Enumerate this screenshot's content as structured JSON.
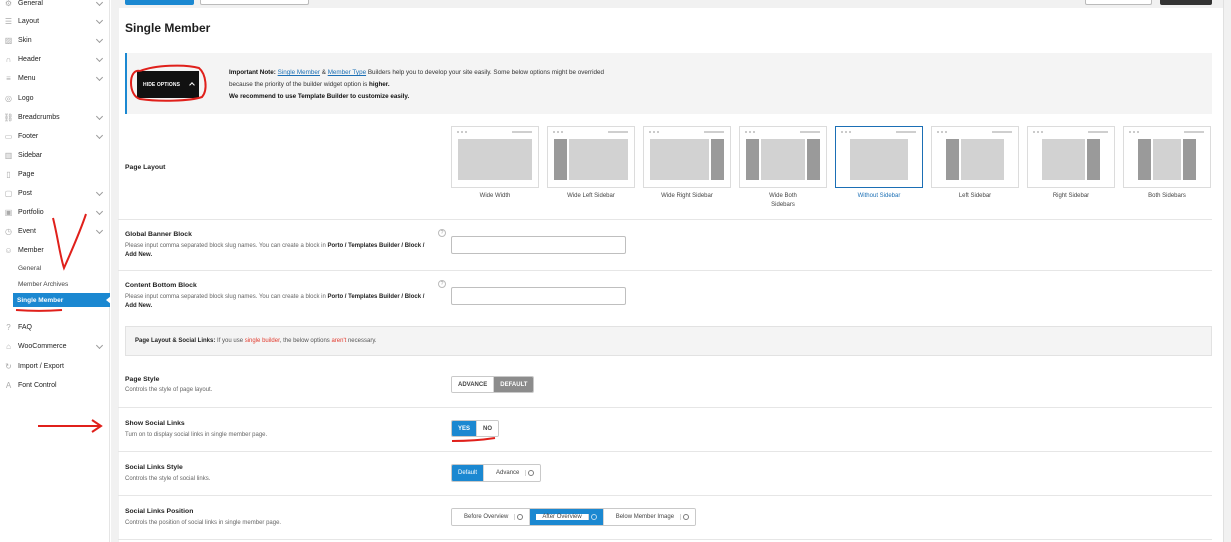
{
  "sidebar": {
    "items": [
      {
        "label": "General",
        "icon": "gear-icon",
        "chevron": true
      },
      {
        "label": "Layout",
        "icon": "layout-icon",
        "chevron": true
      },
      {
        "label": "Skin",
        "icon": "image-icon",
        "chevron": true
      },
      {
        "label": "Header",
        "icon": "header-icon",
        "chevron": true
      },
      {
        "label": "Menu",
        "icon": "menu-icon",
        "chevron": true
      },
      {
        "label": "Logo",
        "icon": "logo-icon",
        "chevron": false
      },
      {
        "label": "Breadcrumbs",
        "icon": "link-icon",
        "chevron": true
      },
      {
        "label": "Footer",
        "icon": "footer-icon",
        "chevron": true
      },
      {
        "label": "Sidebar",
        "icon": "sidebar-icon",
        "chevron": false
      },
      {
        "label": "Page",
        "icon": "page-icon",
        "chevron": false
      },
      {
        "label": "Post",
        "icon": "post-icon",
        "chevron": true
      },
      {
        "label": "Portfolio",
        "icon": "portfolio-icon",
        "chevron": true
      },
      {
        "label": "Event",
        "icon": "event-icon",
        "chevron": true
      },
      {
        "label": "Member",
        "icon": "member-icon",
        "chevron": false
      }
    ],
    "member_sub": [
      "General",
      "Member Archives",
      "Single Member"
    ],
    "bottom_items": [
      {
        "label": "FAQ",
        "icon": "question-icon"
      },
      {
        "label": "WooCommerce",
        "icon": "cart-icon",
        "chevron": true
      },
      {
        "label": "Import / Export",
        "icon": "refresh-icon"
      },
      {
        "label": "Font Control",
        "icon": "font-icon"
      }
    ]
  },
  "page": {
    "title": "Single Member"
  },
  "notice": {
    "button": "HIDE OPTIONS",
    "lead": "Important Note:",
    "link1": "Single Member",
    "amp": "&",
    "link2": "Member Type",
    "text1": "Builders help you to develop your site easily. Some below options might be overrided because the priority of the builder widget option is",
    "strong": "higher.",
    "text2": "We recommend to use Template Builder to customize easily."
  },
  "page_layout": {
    "label": "Page Layout",
    "selected": "Without Sidebar",
    "options": [
      "Wide Width",
      "Wide Left Sidebar",
      "Wide Right Sidebar",
      "Wide Both Sidebars",
      "Without Sidebar",
      "Left Sidebar",
      "Right Sidebar",
      "Both Sidebars"
    ]
  },
  "global_banner": {
    "label": "Global Banner Block",
    "desc1": "Please input comma separated block slug names. You can create a block in",
    "path": "Porto / Templates Builder / Block / Add New.",
    "value": ""
  },
  "content_bottom": {
    "label": "Content Bottom Block",
    "desc1": "Please input comma separated block slug names. You can create a block in",
    "path": "Porto / Templates Builder / Block / Add New.",
    "value": ""
  },
  "info": {
    "lead": "Page Layout & Social Links:",
    "t1": "If you use",
    "red1": "single builder",
    "t2": ", the below options",
    "red2": "aren't",
    "t3": "necessary."
  },
  "page_style": {
    "label": "Page Style",
    "desc": "Controls the style of page layout.",
    "options": [
      "ADVANCE",
      "DEFAULT"
    ],
    "selected": "DEFAULT"
  },
  "social_links": {
    "label": "Show Social Links",
    "desc": "Turn on to display social links in single member page.",
    "options": [
      "YES",
      "NO"
    ],
    "selected": "YES"
  },
  "social_style": {
    "label": "Social Links Style",
    "desc": "Controls the style of social links.",
    "options": [
      "Default",
      "Advance"
    ],
    "selected": "Default"
  },
  "social_position": {
    "label": "Social Links Position",
    "desc": "Controls the position of social links in single member page.",
    "options": [
      "Before Overview",
      "After Overview",
      "Below Member Image"
    ],
    "selected": "After Overview"
  },
  "colors": {
    "accent": "#1b88d1",
    "annotation": "#e0201b"
  }
}
